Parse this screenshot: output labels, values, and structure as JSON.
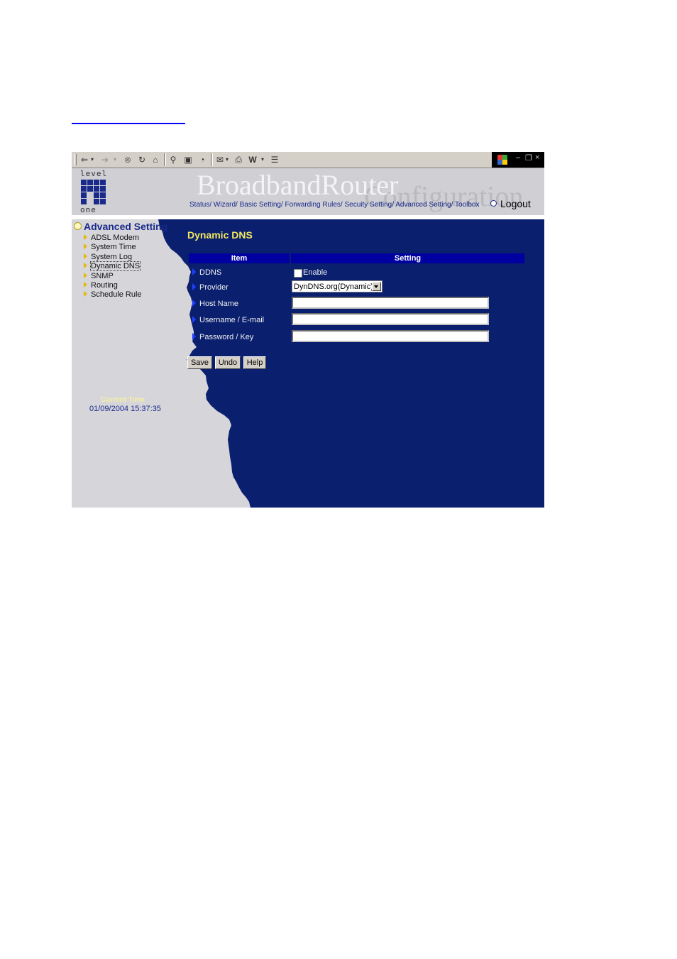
{
  "browser": {
    "toolbar_icons": [
      "back-icon",
      "dropdown-icon",
      "forward-icon",
      "dropdown-icon",
      "stop-icon",
      "refresh-icon",
      "home-icon",
      "search-icon",
      "favorites-icon",
      "history-icon",
      "mail-icon",
      "print-icon",
      "edit-icon",
      "dropdown-icon",
      "discuss-icon"
    ],
    "window_controls": {
      "minimize": "–",
      "restore": "❐",
      "close": "×"
    }
  },
  "header": {
    "logo_top": "level",
    "logo_bottom": "one",
    "brand_title": "BroadbandRouter",
    "brand_subtitle": "Configuration",
    "nav_items": [
      "Status/",
      "Wizard/",
      "Basic Setting/",
      "Forwarding Rules/",
      "Secuity Setting/",
      "Advanced Setting/",
      "Toolbox"
    ],
    "logout": "Logout"
  },
  "sidebar": {
    "title": "Advanced Setting",
    "items": [
      {
        "label": "ADSL Modem"
      },
      {
        "label": "System Time"
      },
      {
        "label": "System Log"
      },
      {
        "label": "Dynamic DNS"
      },
      {
        "label": "SNMP"
      },
      {
        "label": "Routing"
      },
      {
        "label": "Schedule Rule"
      }
    ],
    "active_item": "Dynamic DNS",
    "current_time_label": "Current Time",
    "current_time_value": "01/09/2004 15:37:35"
  },
  "panel": {
    "title": "Dynamic DNS",
    "columns": [
      "Item",
      "Setting"
    ],
    "rows": [
      {
        "label": "DDNS"
      },
      {
        "label": "Provider"
      },
      {
        "label": "Host Name"
      },
      {
        "label": "Username / E-mail"
      },
      {
        "label": "Password / Key"
      }
    ],
    "ddns_enable_label": "Enable",
    "ddns_enabled": false,
    "provider_selected": "DynDNS.org(Dynamic)",
    "host_name_value": "",
    "username_value": "",
    "password_value": "",
    "buttons": {
      "save": "Save",
      "undo": "Undo",
      "help": "Help"
    }
  },
  "colors": {
    "panel_bg": "#0a1f6e",
    "table_header": "#0000a0",
    "title_yellow": "#f4e860",
    "nav_blue": "#1a2a8a"
  }
}
